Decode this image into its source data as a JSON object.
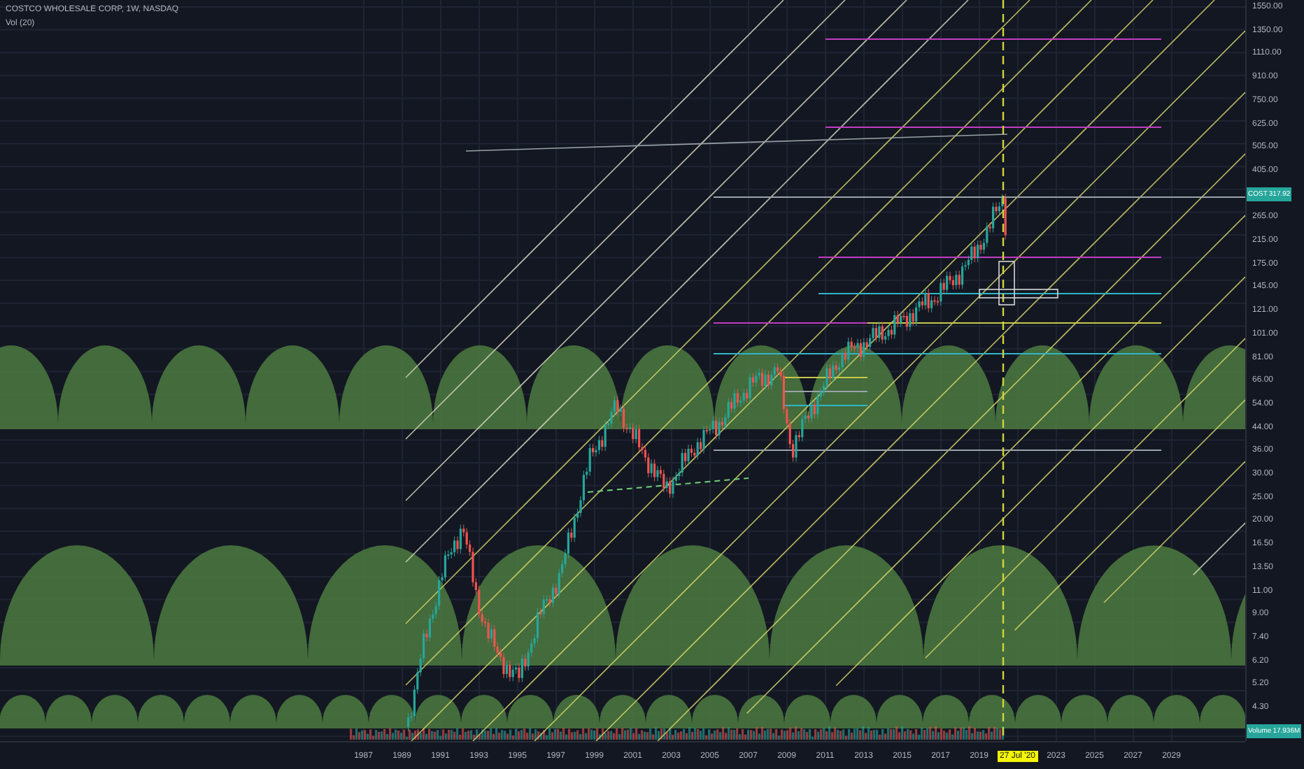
{
  "header": {
    "title": "COSTCO WHOLESALE CORP, 1W, NASDAQ",
    "indicator": "Vol (20)"
  },
  "price_axis": [
    {
      "kind": "tick",
      "label": "1550.00"
    },
    {
      "kind": "tick",
      "label": "1350.00"
    },
    {
      "kind": "tick",
      "label": "1110.00"
    },
    {
      "kind": "tick",
      "label": "910.00"
    },
    {
      "kind": "tick",
      "label": "750.00"
    },
    {
      "kind": "tick",
      "label": "625.00"
    },
    {
      "kind": "tick",
      "label": "505.00"
    },
    {
      "kind": "tick",
      "label": "405.00"
    },
    {
      "kind": "badge",
      "symbol": "COST",
      "value": "317.92"
    },
    {
      "kind": "tick",
      "label": "265.00"
    },
    {
      "kind": "tick",
      "label": "215.00"
    },
    {
      "kind": "tick",
      "label": "175.00"
    },
    {
      "kind": "tick",
      "label": "145.00"
    },
    {
      "kind": "tick",
      "label": "121.00"
    },
    {
      "kind": "tick",
      "label": "101.00"
    },
    {
      "kind": "tick",
      "label": "81.00"
    },
    {
      "kind": "tick",
      "label": "66.00"
    },
    {
      "kind": "tick",
      "label": "54.00"
    },
    {
      "kind": "tick",
      "label": "44.00"
    },
    {
      "kind": "tick",
      "label": "36.00"
    },
    {
      "kind": "tick",
      "label": "30.00"
    },
    {
      "kind": "tick",
      "label": "25.00"
    },
    {
      "kind": "tick",
      "label": "20.00"
    },
    {
      "kind": "tick",
      "label": "16.50"
    },
    {
      "kind": "tick",
      "label": "13.50"
    },
    {
      "kind": "tick",
      "label": "11.00"
    },
    {
      "kind": "tick",
      "label": "9.00"
    },
    {
      "kind": "tick",
      "label": "7.40"
    },
    {
      "kind": "tick",
      "label": "6.20"
    },
    {
      "kind": "tick",
      "label": "5.20"
    },
    {
      "kind": "tick",
      "label": "4.30"
    },
    {
      "kind": "badge",
      "symbol": "Volume",
      "value": "17.936M"
    }
  ],
  "time_axis": [
    {
      "kind": "year",
      "label": "1987"
    },
    {
      "kind": "year",
      "label": "1989"
    },
    {
      "kind": "year",
      "label": "1991"
    },
    {
      "kind": "year",
      "label": "1993"
    },
    {
      "kind": "year",
      "label": "1995"
    },
    {
      "kind": "year",
      "label": "1997"
    },
    {
      "kind": "year",
      "label": "1999"
    },
    {
      "kind": "year",
      "label": "2001"
    },
    {
      "kind": "year",
      "label": "2003"
    },
    {
      "kind": "year",
      "label": "2005"
    },
    {
      "kind": "year",
      "label": "2007"
    },
    {
      "kind": "year",
      "label": "2009"
    },
    {
      "kind": "year",
      "label": "2011"
    },
    {
      "kind": "year",
      "label": "2013"
    },
    {
      "kind": "year",
      "label": "2015"
    },
    {
      "kind": "year",
      "label": "2017"
    },
    {
      "kind": "year",
      "label": "2019"
    },
    {
      "kind": "cursor",
      "label": "27 Jul '20"
    },
    {
      "kind": "year",
      "label": "2023"
    },
    {
      "kind": "year",
      "label": "2025"
    },
    {
      "kind": "year",
      "label": "2027"
    },
    {
      "kind": "year",
      "label": "2029"
    }
  ]
}
